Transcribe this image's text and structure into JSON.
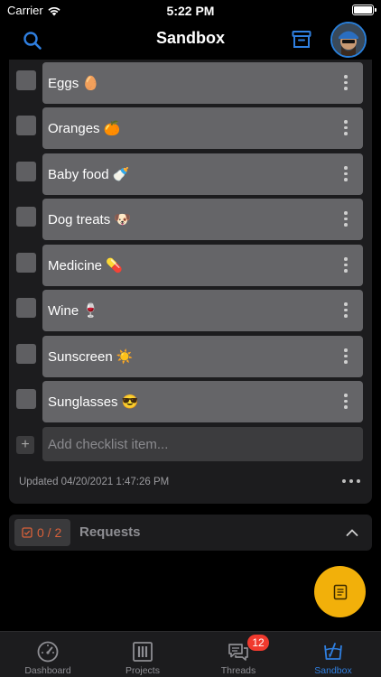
{
  "status_bar": {
    "carrier": "Carrier",
    "time": "5:22 PM",
    "battery_level": 1.0
  },
  "nav": {
    "title": "Sandbox",
    "left_icon": "search-icon",
    "right_icon": "archive-icon",
    "accent_color": "#2f7fe0"
  },
  "checklist": {
    "items": [
      {
        "label": "Eggs 🥚",
        "checked": false
      },
      {
        "label": "Oranges 🍊",
        "checked": false
      },
      {
        "label": "Baby food 🍼",
        "checked": false
      },
      {
        "label": "Dog treats 🐶",
        "checked": false
      },
      {
        "label": "Medicine 💊",
        "checked": false
      },
      {
        "label": "Wine 🍷",
        "checked": false
      },
      {
        "label": "Sunscreen ☀️",
        "checked": false
      },
      {
        "label": "Sunglasses 😎",
        "checked": false
      }
    ],
    "add_placeholder": "Add checklist item...",
    "add_icon": "+",
    "updated": "Updated 04/20/2021 1:47:26 PM"
  },
  "requests": {
    "count": "0 / 2",
    "title": "Requests",
    "badge_color": "#d9613a"
  },
  "fab": {
    "icon": "note-icon",
    "color": "#f2b00a"
  },
  "tab_bar": {
    "tabs": [
      {
        "label": "Dashboard",
        "icon": "gauge-icon",
        "active": false
      },
      {
        "label": "Projects",
        "icon": "projects-icon",
        "active": false
      },
      {
        "label": "Threads",
        "icon": "chat-icon",
        "active": false
      },
      {
        "label": "Sandbox",
        "icon": "sandbox-icon",
        "active": true
      }
    ],
    "threads_badge": "12"
  }
}
